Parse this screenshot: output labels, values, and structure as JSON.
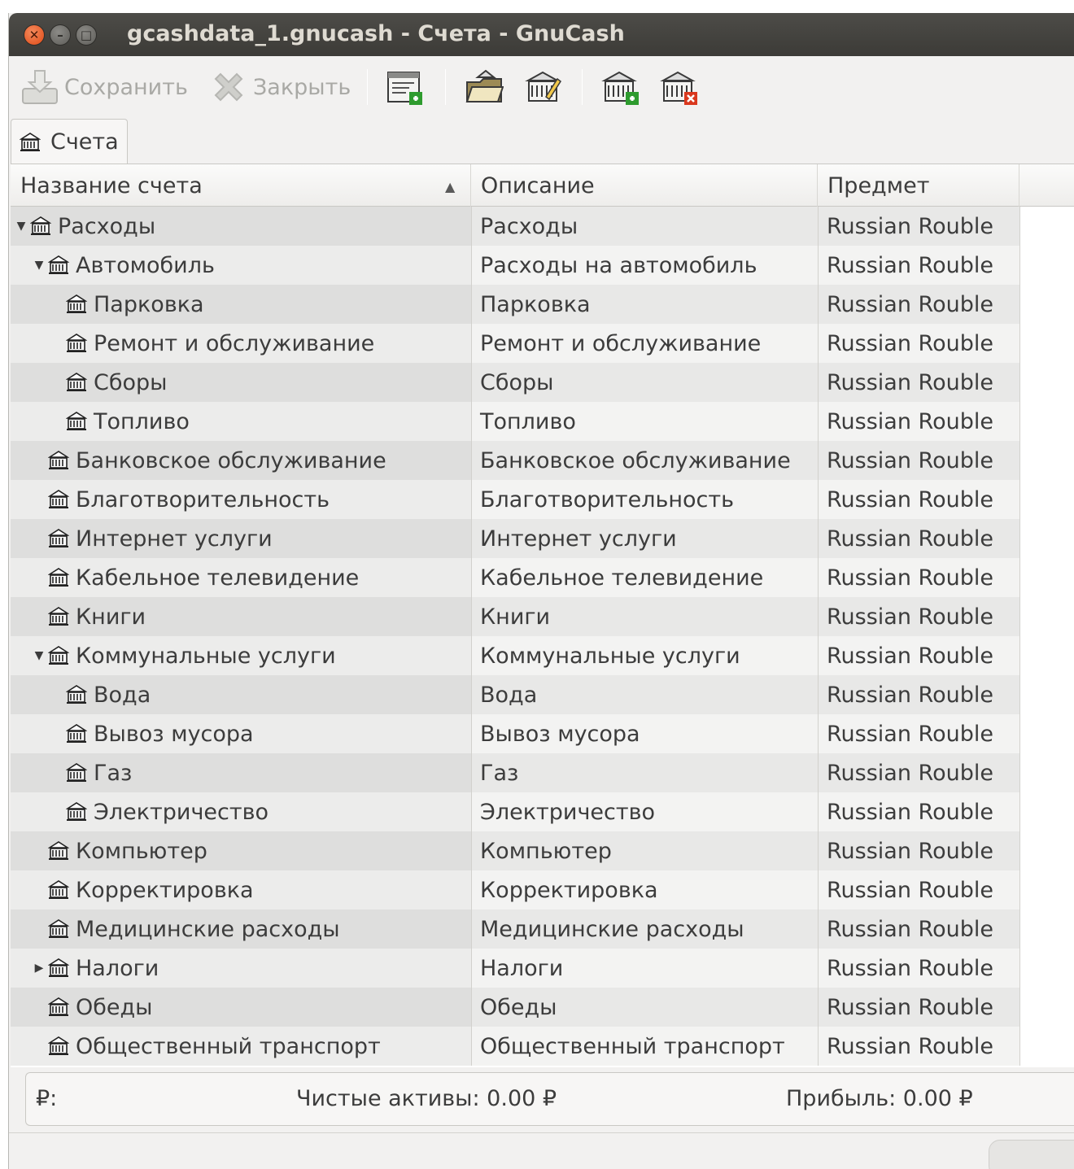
{
  "window": {
    "title": "gcashdata_1.gnucash - Счета - GnuCash",
    "close_glyph": "✕",
    "minimize_glyph": "–",
    "maximize_glyph": "□"
  },
  "toolbar": {
    "save_label": "Сохранить",
    "close_label": "Закрыть",
    "icons": [
      "save-icon",
      "close-icon",
      "new-invoice-icon",
      "open-account-icon",
      "edit-account-icon",
      "new-account-icon",
      "delete-account-icon"
    ]
  },
  "tabs": [
    {
      "label": "Счета",
      "icon": "bank-icon"
    }
  ],
  "table": {
    "columns": [
      "Название счета",
      "Описание",
      "Предмет"
    ],
    "sort_glyph": "▲",
    "rows": [
      {
        "name": "Расходы",
        "description": "Расходы",
        "commodity": "Russian Rouble",
        "expander": "▼"
      },
      {
        "name": "Автомобиль",
        "description": "Расходы на автомобиль",
        "commodity": "Russian Rouble",
        "expander": "▼"
      },
      {
        "name": "Парковка",
        "description": "Парковка",
        "commodity": "Russian Rouble",
        "expander": ""
      },
      {
        "name": "Ремонт и обслуживание",
        "description": "Ремонт и обслуживание",
        "commodity": "Russian Rouble",
        "expander": ""
      },
      {
        "name": "Сборы",
        "description": "Сборы",
        "commodity": "Russian Rouble",
        "expander": ""
      },
      {
        "name": "Топливо",
        "description": "Топливо",
        "commodity": "Russian Rouble",
        "expander": ""
      },
      {
        "name": "Банковское обслуживание",
        "description": "Банковское обслуживание",
        "commodity": "Russian Rouble",
        "expander": ""
      },
      {
        "name": "Благотворительность",
        "description": "Благотворительность",
        "commodity": "Russian Rouble",
        "expander": ""
      },
      {
        "name": "Интернет услуги",
        "description": "Интернет услуги",
        "commodity": "Russian Rouble",
        "expander": ""
      },
      {
        "name": "Кабельное телевидение",
        "description": "Кабельное телевидение",
        "commodity": "Russian Rouble",
        "expander": ""
      },
      {
        "name": "Книги",
        "description": "Книги",
        "commodity": "Russian Rouble",
        "expander": ""
      },
      {
        "name": "Коммунальные услуги",
        "description": "Коммунальные услуги",
        "commodity": "Russian Rouble",
        "expander": "▼"
      },
      {
        "name": "Вода",
        "description": "Вода",
        "commodity": "Russian Rouble",
        "expander": ""
      },
      {
        "name": "Вывоз мусора",
        "description": "Вывоз мусора",
        "commodity": "Russian Rouble",
        "expander": ""
      },
      {
        "name": "Газ",
        "description": "Газ",
        "commodity": "Russian Rouble",
        "expander": ""
      },
      {
        "name": "Электричество",
        "description": "Электричество",
        "commodity": "Russian Rouble",
        "expander": ""
      },
      {
        "name": "Компьютер",
        "description": "Компьютер",
        "commodity": "Russian Rouble",
        "expander": ""
      },
      {
        "name": "Корректировка",
        "description": "Корректировка",
        "commodity": "Russian Rouble",
        "expander": ""
      },
      {
        "name": "Медицинские расходы",
        "description": "Медицинские расходы",
        "commodity": "Russian Rouble",
        "expander": ""
      },
      {
        "name": "Налоги",
        "description": "Налоги",
        "commodity": "Russian Rouble",
        "expander": "▶"
      },
      {
        "name": "Обеды",
        "description": "Обеды",
        "commodity": "Russian Rouble",
        "expander": ""
      },
      {
        "name": "Общественный транспорт",
        "description": "Общественный транспорт",
        "commodity": "Russian Rouble",
        "expander": ""
      }
    ]
  },
  "summary": {
    "currency": "₽:",
    "net_assets": "Чистые активы: 0.00 ₽",
    "profit": "Прибыль: 0.00 ₽"
  }
}
